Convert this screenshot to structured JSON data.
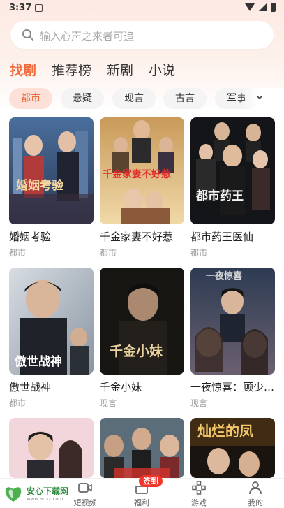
{
  "status_bar": {
    "time": "3:37"
  },
  "search": {
    "placeholder": "输入心声之来者可追"
  },
  "top_tabs": [
    {
      "label": "找剧",
      "active": true
    },
    {
      "label": "推荐榜",
      "active": false
    },
    {
      "label": "新剧",
      "active": false
    },
    {
      "label": "小说",
      "active": false
    }
  ],
  "chips": [
    {
      "label": "都市",
      "active": true
    },
    {
      "label": "悬疑",
      "active": false
    },
    {
      "label": "现言",
      "active": false
    },
    {
      "label": "古言",
      "active": false
    },
    {
      "label": "军事",
      "active": false
    }
  ],
  "dramas": [
    {
      "title": "婚姻考验",
      "genre": "都市",
      "poster_text": "婚姻考验"
    },
    {
      "title": "千金家妻不好惹",
      "genre": "都市",
      "poster_text": "千金家妻不好惹"
    },
    {
      "title": "都市药王医仙",
      "genre": "都市",
      "poster_text": "都市药王"
    },
    {
      "title": "傲世战神",
      "genre": "都市",
      "poster_text": "傲世战神"
    },
    {
      "title": "千金小妹",
      "genre": "现言",
      "poster_text": "千金小妹"
    },
    {
      "title": "一夜惊喜：顾少…",
      "genre": "现言",
      "poster_text": ""
    },
    {
      "title": "",
      "genre": "",
      "poster_text": ""
    },
    {
      "title": "",
      "genre": "",
      "poster_text": ""
    },
    {
      "title": "",
      "genre": "",
      "poster_text": "灿烂的凤"
    }
  ],
  "bottom_nav": [
    {
      "label": "短视频",
      "icon": "video-icon"
    },
    {
      "label": "福利",
      "icon": "gift-icon",
      "badge": "签到"
    },
    {
      "label": "游戏",
      "icon": "gamepad-icon"
    },
    {
      "label": "我的",
      "icon": "person-icon"
    }
  ],
  "watermark": {
    "text": "安心下载网",
    "url": "www.anxz.com"
  }
}
